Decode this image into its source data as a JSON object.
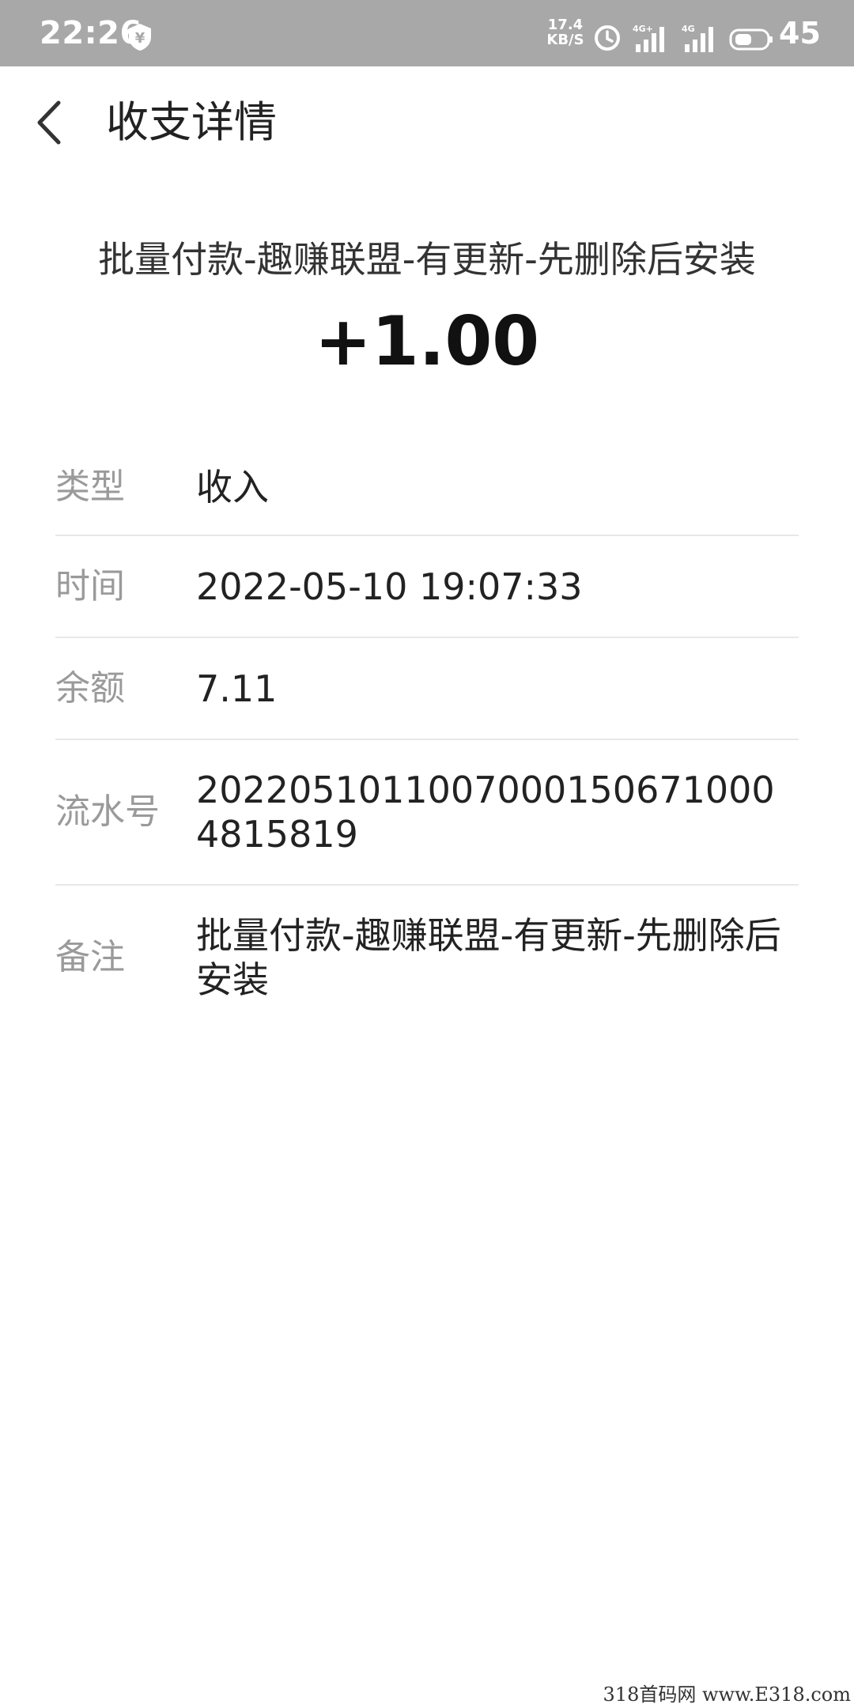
{
  "status_bar": {
    "time": "22:26",
    "shield_label": "¥",
    "net_speed_value": "17.4",
    "net_speed_unit": "KB/S",
    "signal1_label": "4G+",
    "signal2_label": "4G",
    "battery": "45",
    "icons": [
      "shield-icon",
      "alarm-icon",
      "signal-icon",
      "battery-icon"
    ]
  },
  "header": {
    "back_icon": "chevron-left-icon",
    "title": "收支详情"
  },
  "summary": {
    "title": "批量付款-趣赚联盟-有更新-先删除后安装",
    "amount": "+1.00"
  },
  "details": [
    {
      "label": "类型",
      "value": "收入"
    },
    {
      "label": "时间",
      "value": "2022-05-10 19:07:33"
    },
    {
      "label": "余额",
      "value": "7.11"
    },
    {
      "label": "流水号",
      "value": "20220510110070001506710004815819"
    },
    {
      "label": "备注",
      "value": "批量付款-趣赚联盟-有更新-先删除后安装"
    }
  ],
  "watermark": "318首码网 www.E318.com",
  "colors": {
    "status_bar": "#a8a8a8",
    "label_gray": "#9a9a9a",
    "divider": "#e8e8e8",
    "text_dark": "#222222"
  }
}
